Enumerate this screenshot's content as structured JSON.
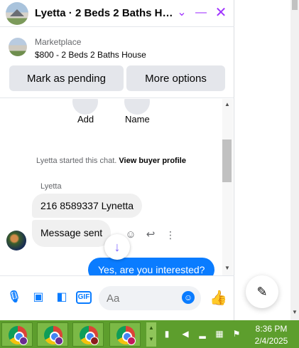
{
  "chat": {
    "header_title": "Lyetta · 2 Beds 2 Baths Ho...",
    "icons": [
      "chevron-down-icon",
      "minimize-icon",
      "close-icon"
    ],
    "accent_color": "#a033ff"
  },
  "listing": {
    "label": "Marketplace",
    "title": "$800 - 2 Beds 2 Baths House",
    "mark_pending_label": "Mark as pending",
    "more_options_label": "More options"
  },
  "quick_actions": [
    {
      "label": "Add",
      "icon": "add-person-icon"
    },
    {
      "label": "Name",
      "icon": "pencil-icon"
    }
  ],
  "system_note": {
    "text": "Lyetta started this chat.",
    "link": "View buyer profile"
  },
  "messages": {
    "sender_name": "Lyetta",
    "incoming": [
      "216 8589337 Lynetta",
      "Message sent"
    ],
    "outgoing": [
      "Yes, are you interested?"
    ],
    "outgoing_color": "#0a7cff"
  },
  "composer": {
    "placeholder": "Aa",
    "gif_label": "GIF",
    "icons": [
      "microphone-icon",
      "photo-icon",
      "sticker-icon",
      "gif-icon",
      "emoji-icon",
      "thumbs-up-icon"
    ]
  },
  "taskbar": {
    "time": "8:36 PM",
    "date": "2/4/2025",
    "color": "#5d9e2d",
    "apps": [
      "chrome-icon",
      "chrome-icon",
      "chrome-icon",
      "chrome-icon"
    ]
  }
}
